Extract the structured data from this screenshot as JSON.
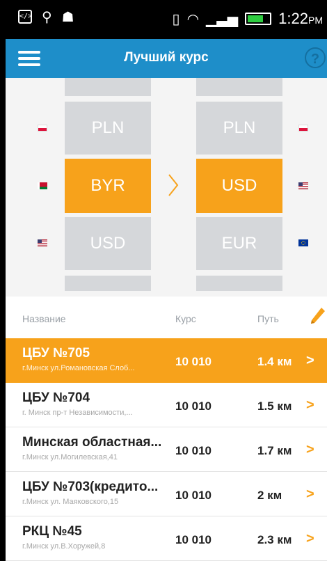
{
  "status_bar": {
    "time": "1:22",
    "ampm": "PM"
  },
  "app_bar": {
    "title": "Лучший курс",
    "help_label": "?"
  },
  "picker": {
    "from_column": [
      "PLN",
      "BYR",
      "USD"
    ],
    "to_column": [
      "PLN",
      "USD",
      "EUR"
    ],
    "selected_from": "BYR",
    "selected_to": "USD"
  },
  "list": {
    "headers": {
      "name": "Название",
      "rate": "Курс",
      "path": "Путь"
    },
    "rows": [
      {
        "name": "ЦБУ №705",
        "address": "г.Минск ул.Романовская Слоб...",
        "rate": "10 010",
        "distance": "1.4 км"
      },
      {
        "name": "ЦБУ №704",
        "address": "г. Минск пр-т Независимости,...",
        "rate": "10 010",
        "distance": "1.5 км"
      },
      {
        "name": "Минская областная...",
        "address": "г.Минск ул.Могилевская,41",
        "rate": "10 010",
        "distance": "1.7 км"
      },
      {
        "name": "ЦБУ №703(кредито...",
        "address": "г.Минск ул. Маяковского,15",
        "rate": "10 010",
        "distance": "2 км"
      },
      {
        "name": "РКЦ №45",
        "address": "г.Минск ул.В.Хоружей,8",
        "rate": "10 010",
        "distance": "2.3 км"
      }
    ]
  },
  "colors": {
    "app_bar": "#1e8ec9",
    "accent": "#f7a21b",
    "picker_cell": "#d5d7da"
  }
}
